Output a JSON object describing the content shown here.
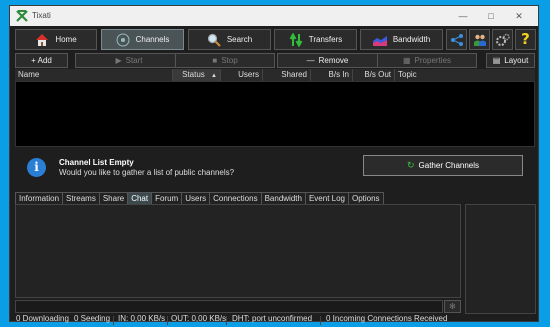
{
  "window": {
    "title": "Tixati"
  },
  "toolbar": {
    "home": "Home",
    "channels": "Channels",
    "search": "Search",
    "transfers": "Transfers",
    "bandwidth": "Bandwidth"
  },
  "actions": {
    "add": "+ Add",
    "start": "Start",
    "stop": "Stop",
    "remove": "Remove",
    "properties": "Properties",
    "layout": "Layout"
  },
  "columns": [
    "Name",
    "Status",
    "Users",
    "Shared",
    "B/s In",
    "B/s Out",
    "Topic"
  ],
  "info": {
    "title": "Channel List Empty",
    "subtitle": "Would you like to gather a list of public channels?",
    "button": "Gather Channels"
  },
  "tabs": [
    "Information",
    "Streams",
    "Share",
    "Chat",
    "Forum",
    "Users",
    "Connections",
    "Bandwidth",
    "Event Log",
    "Options"
  ],
  "active_tab": "Chat",
  "status": {
    "downloading": "0 Downloading",
    "seeding": "0 Seeding",
    "in": "IN: 0,00 KB/s",
    "out": "OUT: 0,00 KB/s",
    "dht": "DHT: port unconfirmed",
    "incoming": "0 Incoming Connections Received"
  },
  "colors": {
    "background": "#0a9ee6",
    "window": "#1e1e1e",
    "accent": "#2a7fd4"
  }
}
